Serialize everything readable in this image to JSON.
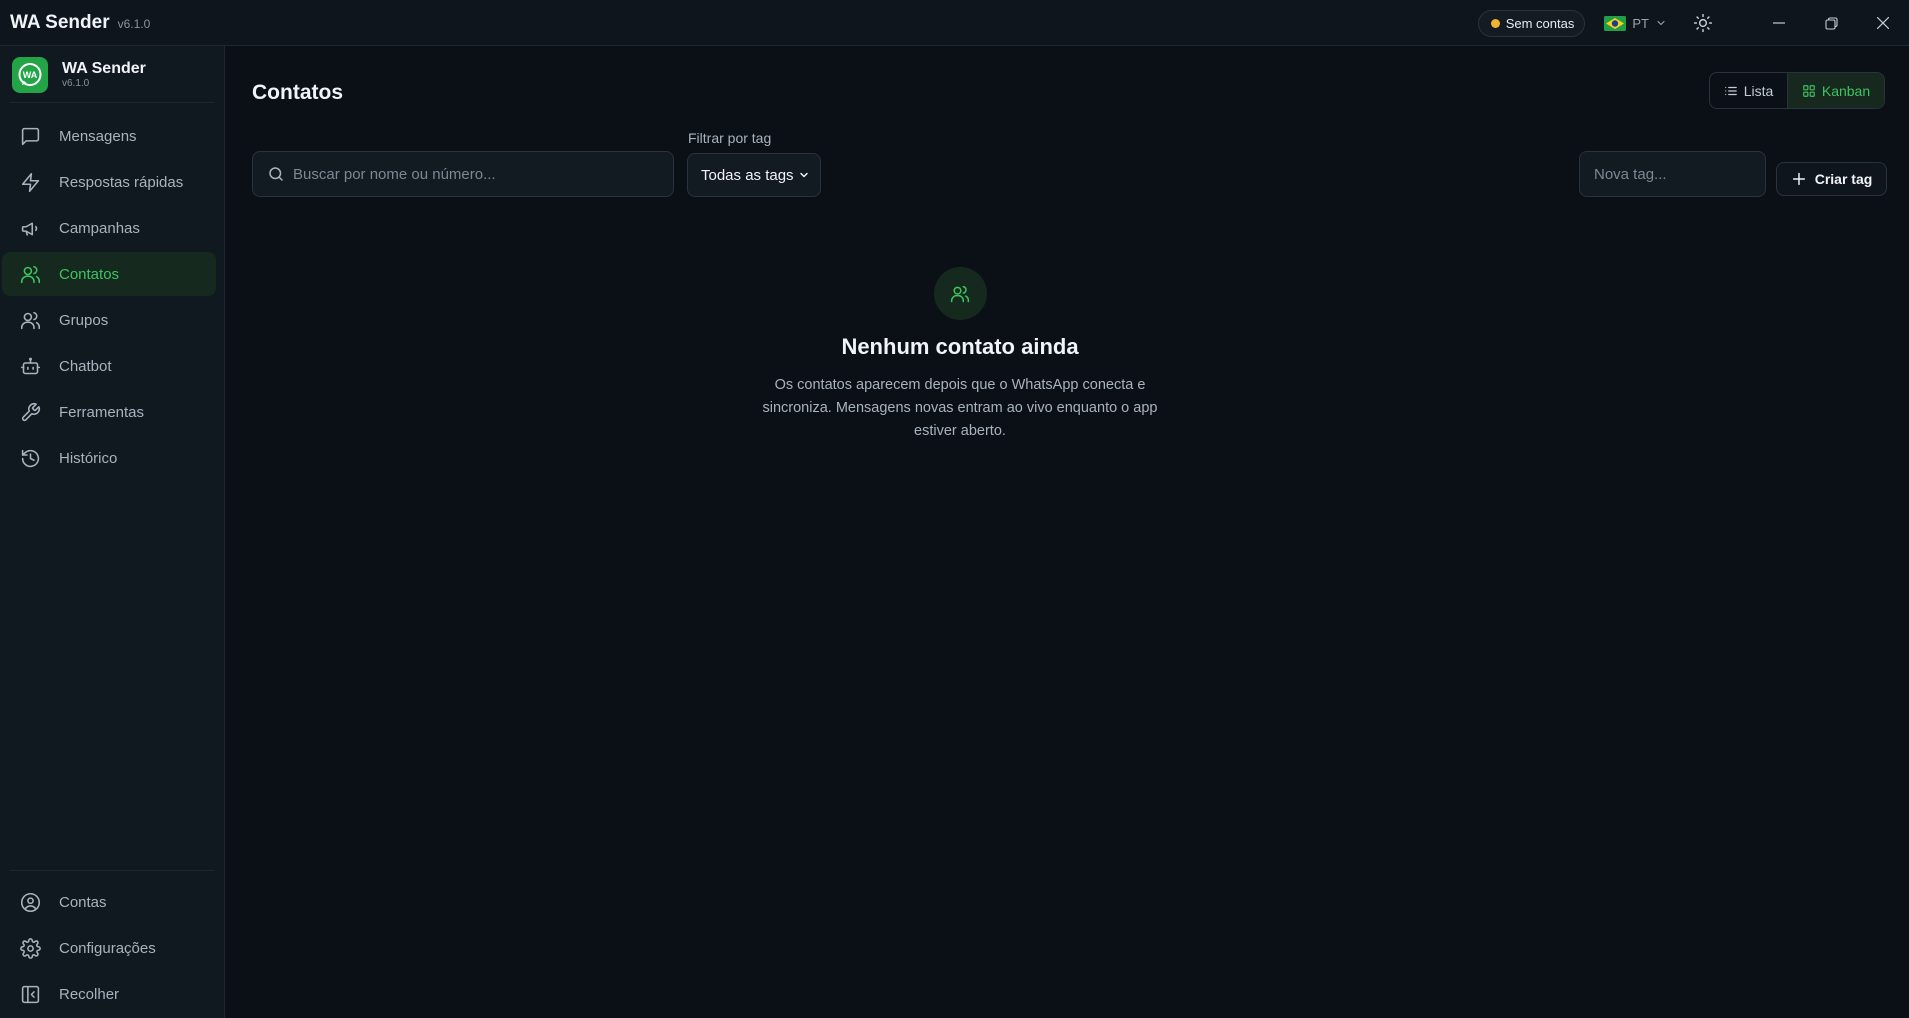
{
  "titlebar": {
    "title": "WA Sender",
    "version": "v6.1.0",
    "status": "Sem contas",
    "status_color": "#f2b42c",
    "language": "PT",
    "theme_icon": "sun-icon",
    "window_controls": [
      "minimize-icon",
      "restore-icon",
      "close-icon"
    ]
  },
  "sidebar": {
    "brand": {
      "name": "WA Sender",
      "version": "v6.1.0",
      "logo_color": "#22a447"
    },
    "items": [
      {
        "label": "Mensagens",
        "icon": "message-square-icon"
      },
      {
        "label": "Respostas rápidas",
        "icon": "zap-icon"
      },
      {
        "label": "Campanhas",
        "icon": "megaphone-icon"
      },
      {
        "label": "Contatos",
        "icon": "users-icon",
        "active": true
      },
      {
        "label": "Grupos",
        "icon": "users-group-icon"
      },
      {
        "label": "Chatbot",
        "icon": "bot-icon"
      },
      {
        "label": "Ferramentas",
        "icon": "wrench-icon"
      },
      {
        "label": "Histórico",
        "icon": "history-icon"
      }
    ],
    "bottom_items": [
      {
        "label": "Contas",
        "icon": "user-circle-icon"
      },
      {
        "label": "Configurações",
        "icon": "settings-gear-icon"
      },
      {
        "label": "Recolher",
        "icon": "collapse-panel-icon"
      }
    ]
  },
  "main": {
    "title": "Contatos",
    "view_toggle": {
      "list_label": "Lista",
      "kanban_label": "Kanban",
      "selected": "Kanban"
    },
    "search": {
      "placeholder": "Buscar por nome ou número...",
      "value": ""
    },
    "filter": {
      "label": "Filtrar por tag",
      "selected": "Todas as tags"
    },
    "new_tag": {
      "placeholder": "Nova tag...",
      "value": ""
    },
    "create_tag_label": "Criar tag",
    "empty_state": {
      "title": "Nenhum contato ainda",
      "description": "Os contatos aparecem depois que o WhatsApp conecta e sincroniza. Mensagens novas entram ao vivo enquanto o app estiver aberto."
    }
  },
  "colors": {
    "accent": "#3cc45f",
    "background": "#0b1016",
    "sidebar": "#101820"
  }
}
